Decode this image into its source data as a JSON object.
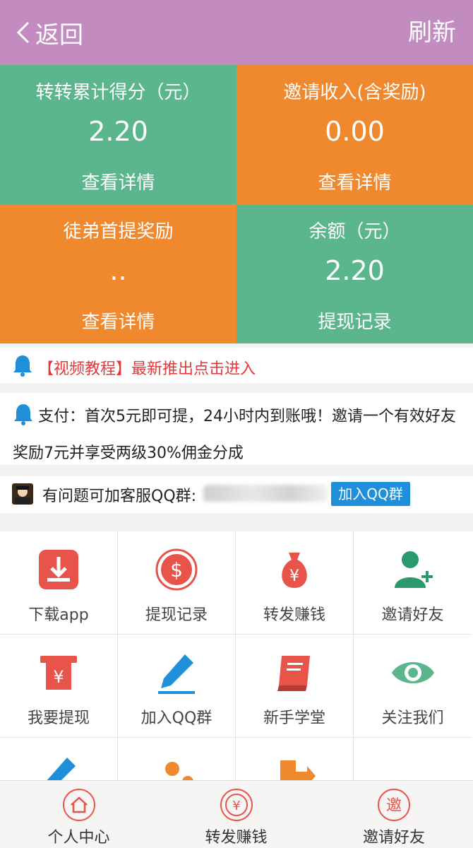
{
  "header": {
    "back_label": "返回",
    "refresh_label": "刷新"
  },
  "stats": [
    {
      "title": "转转累计得分（元）",
      "value": "2.20",
      "link": "查看详情"
    },
    {
      "title": "邀请收入(含奖励)",
      "value": "0.00",
      "link": "查看详情"
    },
    {
      "title": "徒弟首提奖励",
      "value": "..",
      "link": "查看详情"
    },
    {
      "title": "余额（元）",
      "value": "2.20",
      "link": "提现记录"
    }
  ],
  "notices": {
    "video_tutorial": "【视频教程】最新推出点击进入",
    "payment": "支付：首次5元即可提，24小时内到账哦！邀请一个有效好友奖励7元并享受两级30%佣金分成",
    "qq_text": "有问题可加客服QQ群:",
    "qq_button": "加入QQ群"
  },
  "menu": [
    {
      "label": "下载app",
      "icon": "download-icon"
    },
    {
      "label": "提现记录",
      "icon": "dollar-coin-icon"
    },
    {
      "label": "转发赚钱",
      "icon": "money-bag-icon"
    },
    {
      "label": "邀请好友",
      "icon": "add-user-icon"
    },
    {
      "label": "我要提现",
      "icon": "atm-withdraw-icon"
    },
    {
      "label": "加入QQ群",
      "icon": "pencil-icon"
    },
    {
      "label": "新手学堂",
      "icon": "book-icon"
    },
    {
      "label": "关注我们",
      "icon": "eye-icon"
    },
    {
      "label": "",
      "icon": "pencil-icon"
    },
    {
      "label": "",
      "icon": "customer-service-icon"
    },
    {
      "label": "",
      "icon": "exit-door-icon"
    },
    {
      "label": "",
      "icon": ""
    }
  ],
  "tabs": [
    {
      "label": "个人中心",
      "icon": "home-icon"
    },
    {
      "label": "转发赚钱",
      "icon": "yen-coin-icon"
    },
    {
      "label": "邀请好友",
      "icon": "invite-icon",
      "glyph": "邀"
    }
  ],
  "colors": {
    "header": "#c28cc0",
    "green": "#5bb68d",
    "orange": "#f0882e",
    "accent_red": "#e8534a",
    "link_blue": "#1e8fd8"
  }
}
